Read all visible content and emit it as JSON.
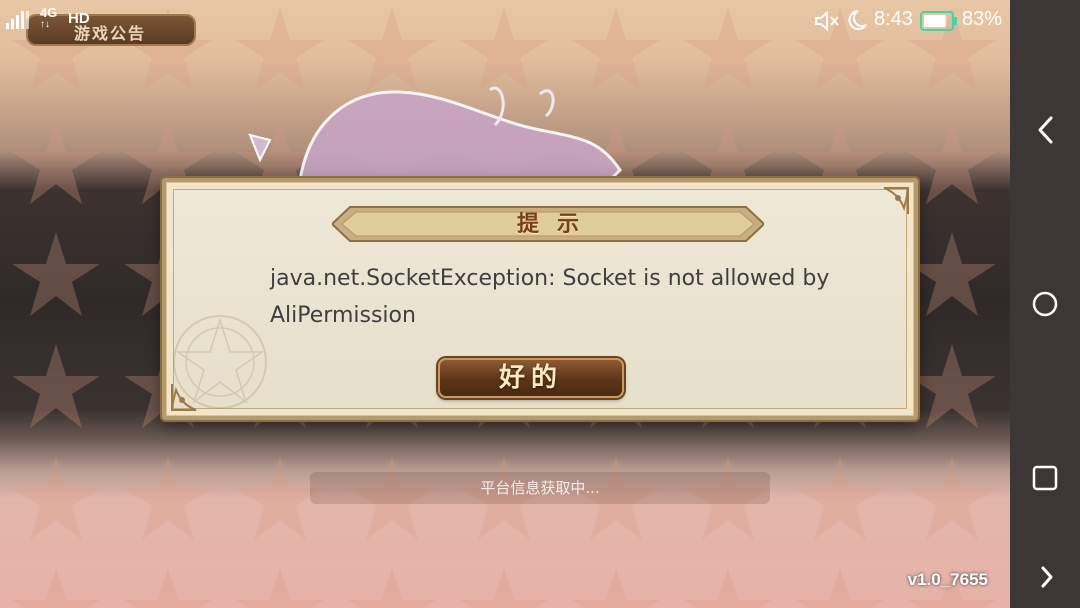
{
  "status_bar": {
    "network_type": "4G",
    "network_arrows": "↑↓",
    "hd_label": "HD",
    "time": "8:43",
    "battery_percent": "83%",
    "battery_level": 0.83,
    "icons": [
      "signal-icon",
      "mute-icon",
      "moon-icon",
      "battery-icon"
    ]
  },
  "game": {
    "notice_tab_label": "游戏公告",
    "loading_text": "平台信息获取中...",
    "version_text": "v1.0_7655"
  },
  "dialog": {
    "title": "提示",
    "message": "java.net.SocketException: Socket is not allowed by AliPermission",
    "ok_button_label": "好的"
  },
  "nav_bar": {
    "icons": [
      "back-icon",
      "home-icon",
      "recent-apps-icon",
      "chevron-right-icon"
    ]
  },
  "colors": {
    "dialog_bg": "#eee8d6",
    "dialog_border": "#b79a6a",
    "title_text": "#7a3f18",
    "button_bg": "#5c3518",
    "button_text": "#fbeac4"
  }
}
